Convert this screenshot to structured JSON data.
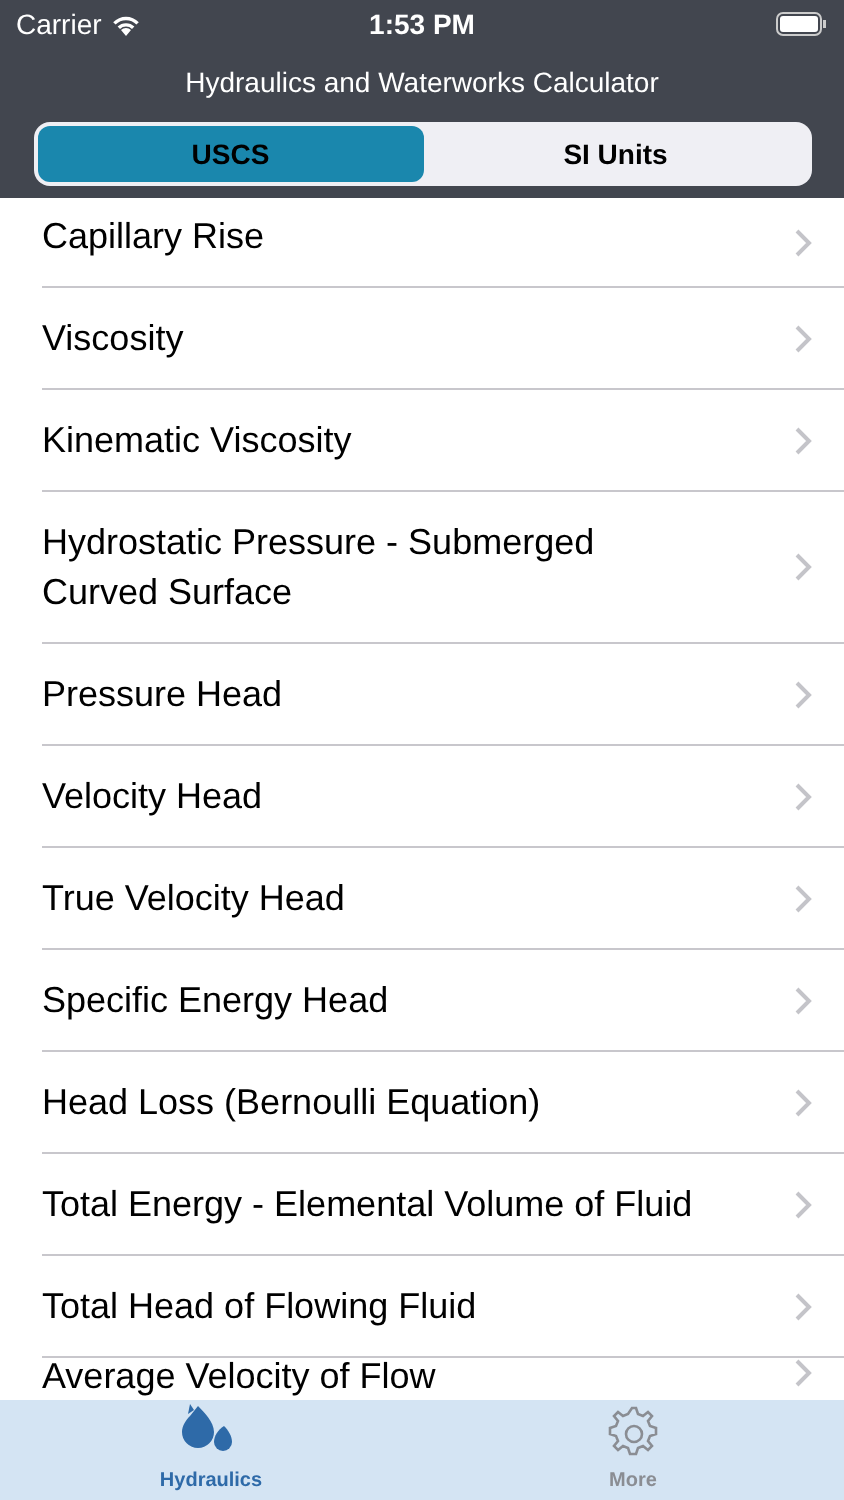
{
  "status_bar": {
    "carrier": "Carrier",
    "time": "1:53 PM"
  },
  "title": "Hydraulics and Waterworks Calculator",
  "segments": [
    {
      "label": "USCS",
      "selected": true
    },
    {
      "label": "SI Units",
      "selected": false
    }
  ],
  "items": [
    {
      "label": "Capillary Rise"
    },
    {
      "label": "Viscosity"
    },
    {
      "label": "Kinematic Viscosity"
    },
    {
      "label": "Hydrostatic Pressure - Submerged Curved Surface"
    },
    {
      "label": "Pressure Head"
    },
    {
      "label": "Velocity Head"
    },
    {
      "label": "True Velocity Head"
    },
    {
      "label": "Specific Energy Head"
    },
    {
      "label": "Head Loss (Bernoulli Equation)"
    },
    {
      "label": "Total Energy - Elemental Volume of Fluid"
    },
    {
      "label": "Total Head of Flowing Fluid"
    },
    {
      "label": "Average Velocity of Flow"
    }
  ],
  "tab_bar": [
    {
      "label": "Hydraulics",
      "kind": "drops",
      "selected": true
    },
    {
      "label": "More",
      "kind": "gear",
      "selected": false
    }
  ]
}
